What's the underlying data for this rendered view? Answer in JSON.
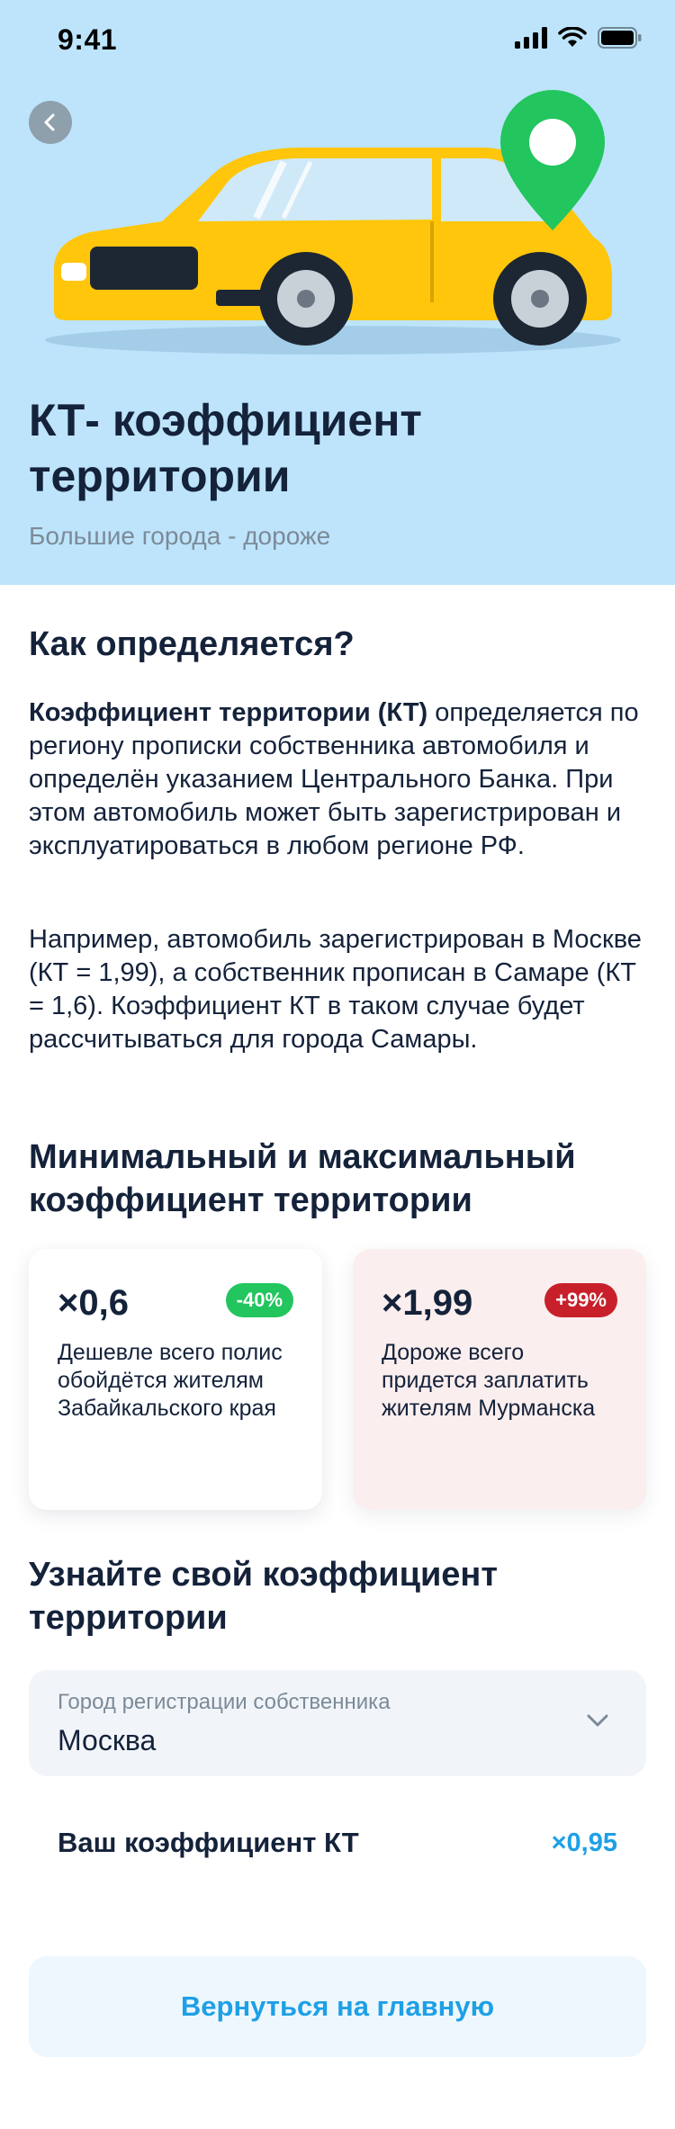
{
  "status_bar": {
    "time": "9:41"
  },
  "hero": {
    "title": "КТ- коэффициент территории",
    "subtitle": "Большие города - дороже"
  },
  "how": {
    "heading": "Как определяется?",
    "p1_bold": "Коэффициент территории (КТ)",
    "p1_rest": " определяется по региону прописки собственника автомобиля и определён указанием Центрального Банка. При этом автомобиль может быть зарегистрирован и эксплуатироваться в любом регионе РФ.",
    "p2": "Например, автомобиль зарегистрирован в Москве (КТ = 1,99), а собственник прописан в Самаре (КТ = 1,6). Коэффициент КТ в таком случае будет рассчитываться для города Самары."
  },
  "range": {
    "heading": "Минимальный и максимальный коэффициент территории",
    "min": {
      "value": "×0,6",
      "badge": "-40%",
      "desc": "Дешевле всего полис обойдётся жителям Забайкальского края"
    },
    "max": {
      "value": "×1,99",
      "badge": "+99%",
      "desc": "Дороже всего придется заплатить жителям Мурманска"
    }
  },
  "calc": {
    "heading": "Узнайте свой коэффициент территории",
    "select_label": "Город регистрации собственника",
    "select_value": "Москва",
    "result_label": "Ваш коэффициент КТ",
    "result_value": "×0,95"
  },
  "footer": {
    "home_button": "Вернуться на главную"
  },
  "colors": {
    "hero_bg": "#bde4fb",
    "accent": "#1ea0e6",
    "badge_green": "#22c55e",
    "badge_red": "#c8202a",
    "car_yellow": "#ffc60b",
    "pin_green": "#22c55e"
  },
  "icons": {
    "back": "chevron-left-icon",
    "select": "chevron-down-icon",
    "pin": "location-pin-icon"
  }
}
